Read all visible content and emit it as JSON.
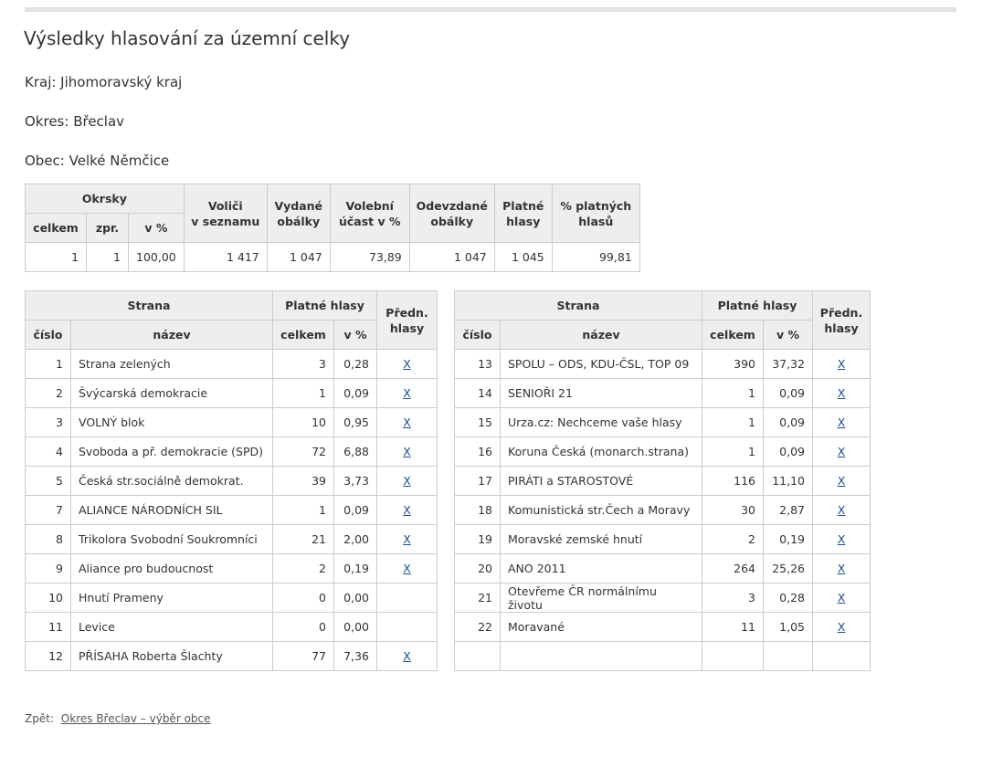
{
  "page": {
    "title": "Výsledky hlasování za územní celky",
    "kraj": "Kraj: Jihomoravský kraj",
    "okres": "Okres: Břeclav",
    "obec": "Obec: Velké Němčice"
  },
  "summary": {
    "headers": {
      "okrsky": "Okrsky",
      "celkem": "celkem",
      "zpr": "zpr.",
      "v_pct": "v %",
      "volici_line1": "Voliči",
      "volici_line2": "v seznamu",
      "vydane_line1": "Vydané",
      "vydane_line2": "obálky",
      "ucast_line1": "Volební",
      "ucast_line2": "účast v %",
      "odevzdane_line1": "Odevzdané",
      "odevzdane_line2": "obálky",
      "platne_line1": "Platné",
      "platne_line2": "hlasy",
      "pct_platnych_line1": "% platných",
      "pct_platnych_line2": "hlasů"
    },
    "row": {
      "celkem": "1",
      "zpr": "1",
      "v_pct": "100,00",
      "volici": "1 417",
      "vydane": "1 047",
      "ucast": "73,89",
      "odevzdane": "1 047",
      "platne": "1 045",
      "pct_platnych": "99,81"
    }
  },
  "party_headers": {
    "strana": "Strana",
    "platne_hlasy": "Platné hlasy",
    "predn_line1": "Předn.",
    "predn_line2": "hlasy",
    "cislo": "číslo",
    "nazev": "název",
    "celkem": "celkem",
    "v_pct": "v %"
  },
  "parties_left": [
    {
      "cislo": "1",
      "nazev": "Strana zelených",
      "celkem": "3",
      "pct": "0,28",
      "x": "X"
    },
    {
      "cislo": "2",
      "nazev": "Švýcarská demokracie",
      "celkem": "1",
      "pct": "0,09",
      "x": "X"
    },
    {
      "cislo": "3",
      "nazev": "VOLNÝ blok",
      "celkem": "10",
      "pct": "0,95",
      "x": "X"
    },
    {
      "cislo": "4",
      "nazev": "Svoboda a př. demokracie (SPD)",
      "celkem": "72",
      "pct": "6,88",
      "x": "X"
    },
    {
      "cislo": "5",
      "nazev": "Česká str.sociálně demokrat.",
      "celkem": "39",
      "pct": "3,73",
      "x": "X"
    },
    {
      "cislo": "7",
      "nazev": "ALIANCE NÁRODNÍCH SIL",
      "celkem": "1",
      "pct": "0,09",
      "x": "X"
    },
    {
      "cislo": "8",
      "nazev": "Trikolora Svobodní Soukromníci",
      "celkem": "21",
      "pct": "2,00",
      "x": "X"
    },
    {
      "cislo": "9",
      "nazev": "Aliance pro budoucnost",
      "celkem": "2",
      "pct": "0,19",
      "x": "X"
    },
    {
      "cislo": "10",
      "nazev": "Hnutí Prameny",
      "celkem": "0",
      "pct": "0,00",
      "x": ""
    },
    {
      "cislo": "11",
      "nazev": "Levice",
      "celkem": "0",
      "pct": "0,00",
      "x": ""
    },
    {
      "cislo": "12",
      "nazev": "PŘÍSAHA Roberta Šlachty",
      "celkem": "77",
      "pct": "7,36",
      "x": "X"
    }
  ],
  "parties_right": [
    {
      "cislo": "13",
      "nazev": "SPOLU – ODS, KDU-ČSL, TOP 09",
      "celkem": "390",
      "pct": "37,32",
      "x": "X"
    },
    {
      "cislo": "14",
      "nazev": "SENIOŘI 21",
      "celkem": "1",
      "pct": "0,09",
      "x": "X"
    },
    {
      "cislo": "15",
      "nazev": "Urza.cz: Nechceme vaše hlasy",
      "celkem": "1",
      "pct": "0,09",
      "x": "X"
    },
    {
      "cislo": "16",
      "nazev": "Koruna Česká (monarch.strana)",
      "celkem": "1",
      "pct": "0,09",
      "x": "X"
    },
    {
      "cislo": "17",
      "nazev": "PIRÁTI a STAROSTOVÉ",
      "celkem": "116",
      "pct": "11,10",
      "x": "X"
    },
    {
      "cislo": "18",
      "nazev": "Komunistická str.Čech a Moravy",
      "celkem": "30",
      "pct": "2,87",
      "x": "X"
    },
    {
      "cislo": "19",
      "nazev": "Moravské zemské hnutí",
      "celkem": "2",
      "pct": "0,19",
      "x": "X"
    },
    {
      "cislo": "20",
      "nazev": "ANO 2011",
      "celkem": "264",
      "pct": "25,26",
      "x": "X"
    },
    {
      "cislo": "21",
      "nazev": "Otevřeme ČR normálnímu životu",
      "celkem": "3",
      "pct": "0,28",
      "x": "X"
    },
    {
      "cislo": "22",
      "nazev": "Moravané",
      "celkem": "11",
      "pct": "1,05",
      "x": "X"
    },
    {
      "cislo": "",
      "nazev": "",
      "celkem": "",
      "pct": "",
      "x": ""
    }
  ],
  "footer": {
    "back_label": "Zpět:",
    "back_link": "Okres Břeclav – výběr obce"
  },
  "colors": {
    "header_bg": "#eeeeee",
    "border": "#cccccc",
    "link": "#1a4a8f"
  }
}
